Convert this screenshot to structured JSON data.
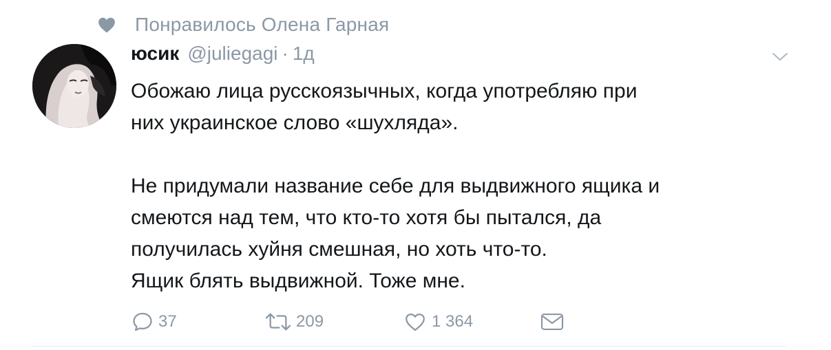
{
  "liked_by": {
    "text": "Понравилось Олена Гарная",
    "icon": "heart-icon"
  },
  "tweet": {
    "author": {
      "name": "юсик",
      "handle": "@juliegagi",
      "avatar_icon": "avatar-photo"
    },
    "separator": "·",
    "time": "1д",
    "menu_icon": "chevron-down-icon",
    "paragraphs": [
      "Обожаю лица русскоязычных, когда употребляю при\nних украинское слово «шухляда».",
      "Не придумали название себе для выдвижного ящика и\nсмеются над тем, что кто-то хотя бы пытался, да\nполучилась хуйня смешная, но хоть что-то.\nЯщик блять выдвижной. Тоже мне."
    ],
    "actions": {
      "reply_count": "37",
      "retweet_count": "209",
      "like_count": "1 364",
      "reply_icon": "reply-icon",
      "retweet_icon": "retweet-icon",
      "like_icon": "heart-outline-icon",
      "dm_icon": "envelope-icon"
    }
  },
  "colors": {
    "text_primary": "#14171a",
    "text_secondary": "#8b98a5",
    "divider": "#e1e8ed"
  }
}
